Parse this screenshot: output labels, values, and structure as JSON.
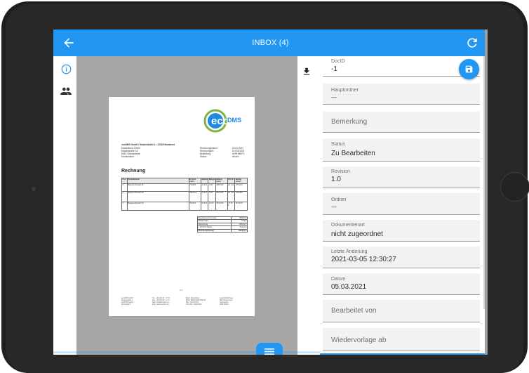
{
  "appbar": {
    "title": "INBOX (4)",
    "back_icon": "arrow-back-icon",
    "refresh_icon": "refresh-icon",
    "color": "#2196f3"
  },
  "rail": {
    "icons": [
      "info-icon",
      "people-icon"
    ]
  },
  "viewer": {
    "download_icon": "download-icon",
    "menu_icon": "menu-icon",
    "document": {
      "logo_text": "eco",
      "logo_text2": "DMS",
      "sender_line": "ecoDMS GmbH • Musterstraße 1 • 12345 Musterort",
      "recipient": [
        "Musterfirma GmbH",
        "Musterstraße 1A",
        "54321 Musterstadt",
        "Deutschland"
      ],
      "meta_labels": [
        "Rechnungsdatum:",
        "Rechnungsnr.:",
        "Bestellung:",
        "Status:"
      ],
      "meta_values": [
        "24.02.2021",
        "ECO301021",
        "AVRH08071",
        "Neuerl"
      ],
      "heading": "Rechnung",
      "table_headers": [
        "Pos.",
        "Produktname",
        "E-Preis netto",
        "Rabatt",
        "Menge",
        "Betrag netto",
        "USt %",
        "Betrag brutto"
      ],
      "table_rows": [
        [
          "1",
          "Beispiel Produkt 01",
          "79,00 €",
          "0,00 €",
          "2,00",
          "158,00 €",
          "16,1 %",
          "175,11 €"
        ],
        [
          "2",
          "Beispiel Produkt 02",
          "328,00 €",
          "0,00 €",
          "2,00",
          "656,00 €",
          "16,1 %",
          "333,28 €"
        ],
        [
          "3",
          "Beispiel Produkt 03",
          "39,00 €",
          "0,00 €",
          "12,00",
          "304,00 €",
          "47,50 €",
          "357,50 €"
        ]
      ],
      "totals": [
        [
          "Zwischensumme netto",
          "868,00 €"
        ],
        [
          "Rabatt netto",
          "0,00 €"
        ],
        [
          "Nettobetrag",
          "868,00 €"
        ],
        [
          "+ 16,00 % MwSt.",
          "161,11 €"
        ],
        [
          "Rechnungsbetrag",
          "1003,11 €"
        ]
      ],
      "page_no": "1/1",
      "footer": [
        "ecoDMS GmbH\nMusterstraße 1\n12345 Musterort\nDeutschland",
        "Tel.: +49 123 45 - 6 7 8\nFax: +49 123 45 - 6 7 9\nMail: info@ecodms.de\nWeb: www.ecodms.de",
        "Bank: Musterbank\nIBAN: DE00 0000 0000 00\nBIC: XXXXXXXX\nUSt-IdNr.: DE000000",
        "Geschäftsführung\nMax Mustermann\nAmtsgericht\nHRB 00000"
      ]
    }
  },
  "panel": {
    "save_icon": "save-icon",
    "fields": [
      {
        "label": "DocID",
        "value": "-1"
      },
      {
        "label": "Hauptordner",
        "value": "---"
      },
      {
        "label": "",
        "value": "",
        "placeholder": "Bemerkung"
      },
      {
        "label": "Status",
        "value": "Zu Bearbeiten"
      },
      {
        "label": "Revision",
        "value": "1.0"
      },
      {
        "label": "Ordner",
        "value": "---"
      },
      {
        "label": "Dokumentenart",
        "value": "nicht zugeordnet"
      },
      {
        "label": "Letzte Änderung",
        "value": "2021-03-05 12:30:27"
      },
      {
        "label": "Datum",
        "value": "05.03.2021"
      },
      {
        "label": "",
        "value": "",
        "placeholder": "Bearbeitet von"
      },
      {
        "label": "",
        "value": "",
        "placeholder": "Wiedervorlage ab"
      }
    ]
  }
}
